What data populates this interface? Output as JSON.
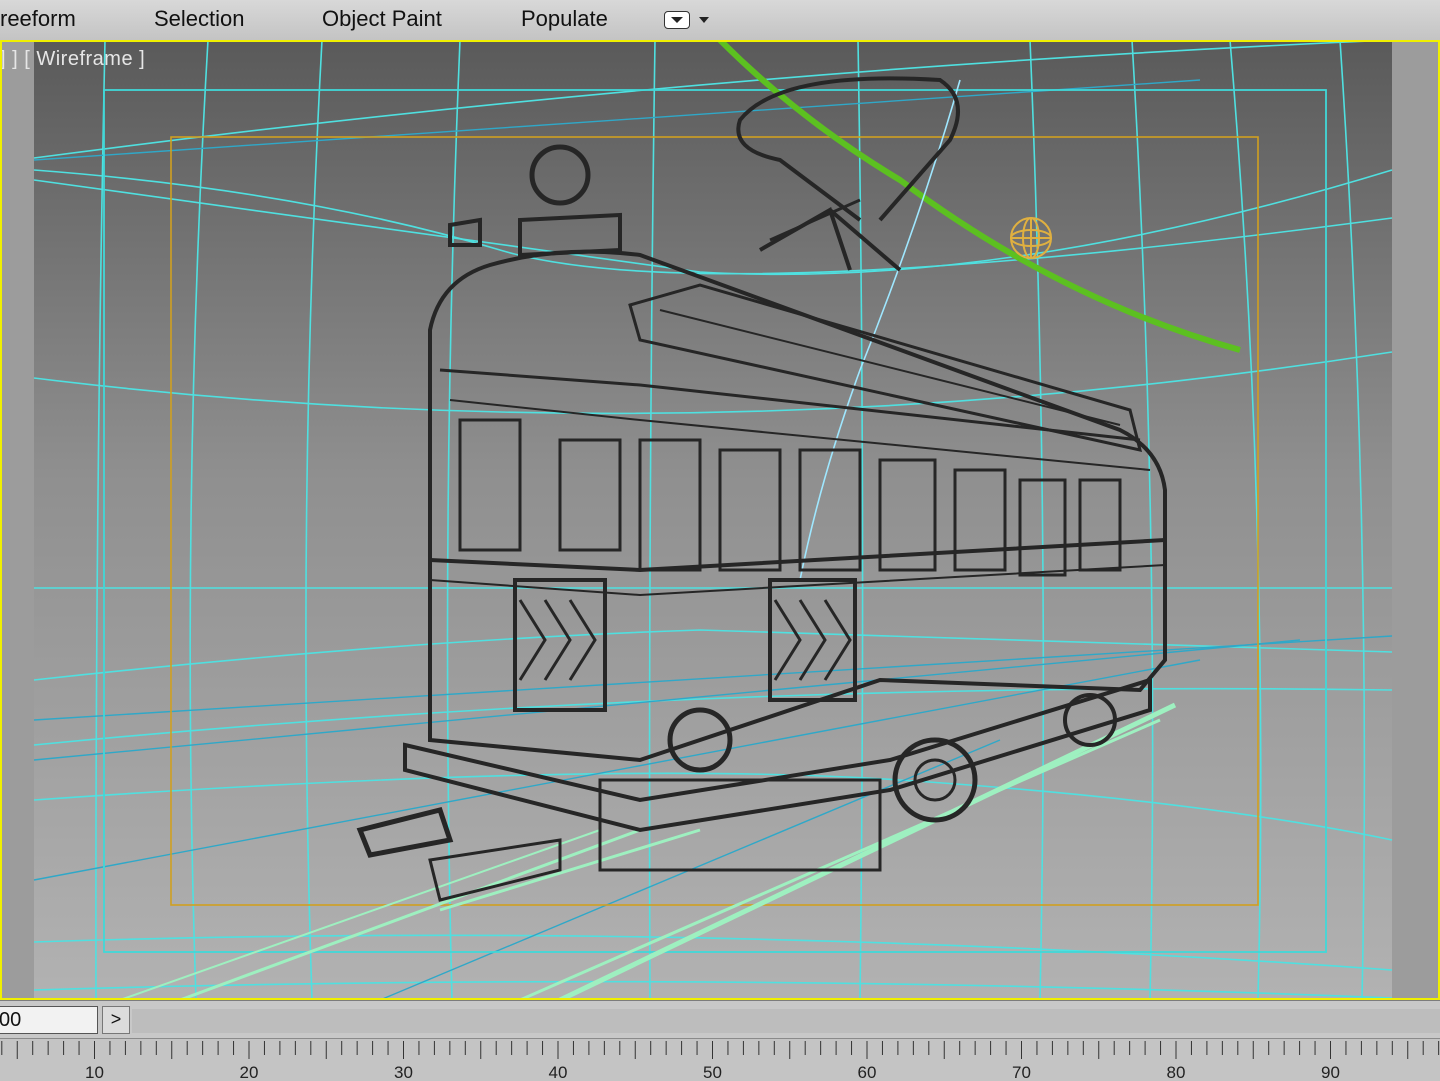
{
  "ribbon": {
    "tabs": [
      {
        "label": "reeform"
      },
      {
        "label": "Selection"
      },
      {
        "label": "Object Paint"
      },
      {
        "label": "Populate"
      }
    ]
  },
  "viewport": {
    "label": "] ] [ Wireframe ]",
    "colors": {
      "background": "#a5a5a5",
      "active_border": "#f0f000",
      "camera_grid": "#4fe0e0",
      "safe_frame_action": "#40d8d8",
      "safe_frame_title": "#d0a020",
      "wireframe": "#262626",
      "spline": "#5cc020",
      "rails": "#9ef0c0",
      "light_gizmo": "#e0b040"
    }
  },
  "timeslider": {
    "frame_value": "00",
    "next_label": ">"
  },
  "trackbar": {
    "tick_labels": [
      "10",
      "20",
      "30",
      "40",
      "50",
      "60",
      "70",
      "80",
      "90"
    ]
  }
}
